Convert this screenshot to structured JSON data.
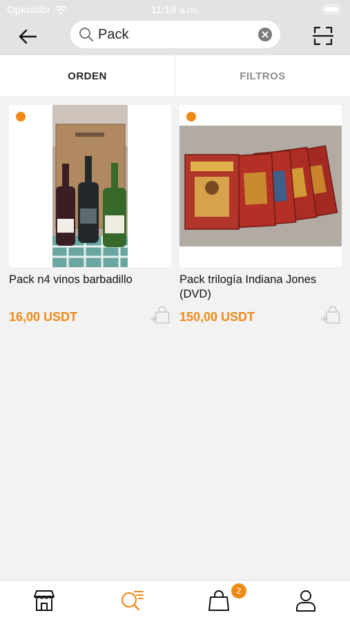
{
  "status_bar": {
    "carrier": "Operador",
    "time": "11:18 a.m."
  },
  "search": {
    "query": "Pack"
  },
  "tabs": {
    "order_label": "ORDEN",
    "filters_label": "FILTROS"
  },
  "products": [
    {
      "title": "Pack n4 vinos barbadillo",
      "price": "16,00 USDT"
    },
    {
      "title": "Pack trilogía Indiana Jones (DVD)",
      "price": "150,00 USDT"
    }
  ],
  "bottom_nav": {
    "cart_count": "2"
  },
  "colors": {
    "accent": "#ef8a17",
    "header_bg": "#e3e3e3"
  }
}
